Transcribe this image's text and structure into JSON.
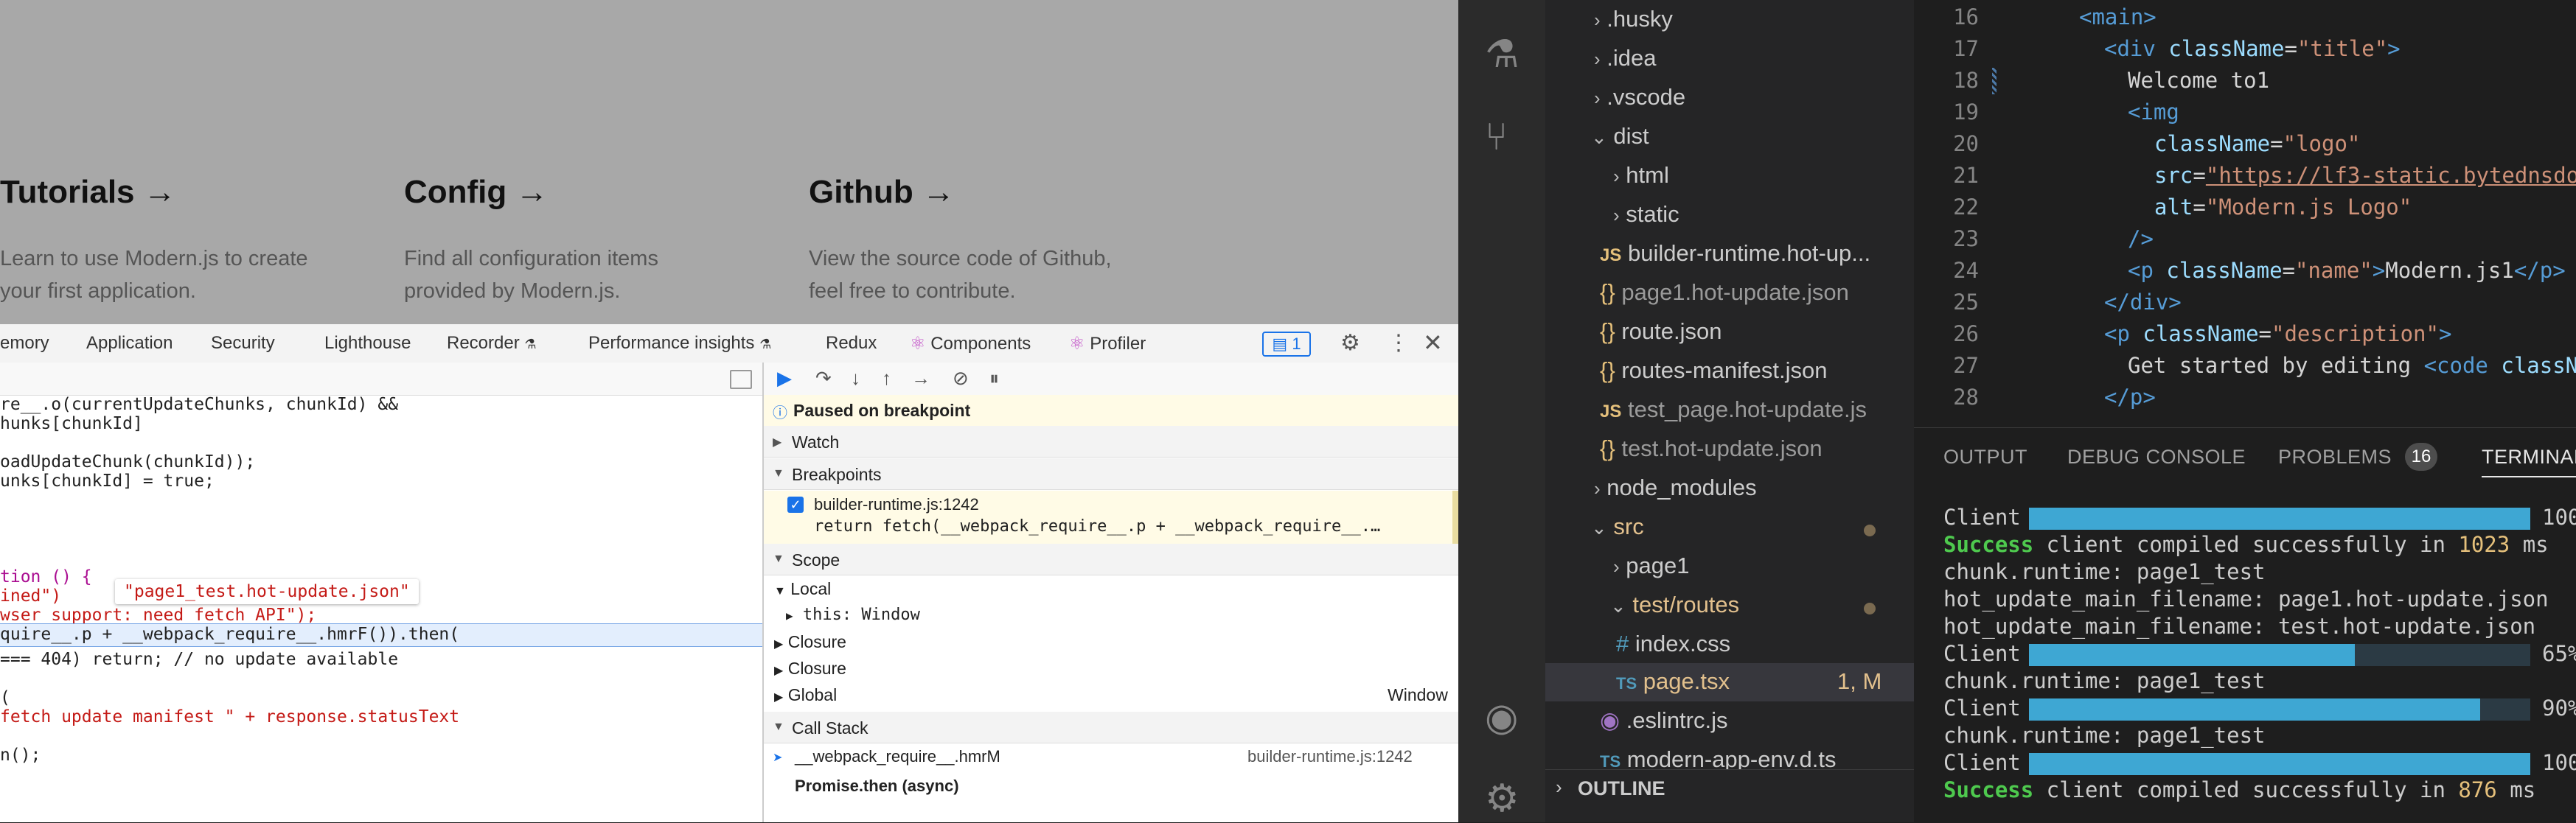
{
  "browser": {
    "cards": [
      {
        "title": "Tutorials →",
        "desc1": "Learn to use Modern.js to create",
        "desc2": "your first application."
      },
      {
        "title": "Config →",
        "desc1": "Find all configuration items",
        "desc2": "provided by Modern.js."
      },
      {
        "title": "Github →",
        "desc1": "View the source code of Github,",
        "desc2": "feel free to contribute."
      }
    ]
  },
  "devtools": {
    "tabs": [
      "emory",
      "Application",
      "Security",
      "Lighthouse",
      "Recorder",
      "Performance insights",
      "Redux",
      "Components",
      "Profiler"
    ],
    "issue_count": "1",
    "code_lines": [
      "re__.o(currentUpdateChunks, chunkId) &&",
      "hunks[chunkId]",
      "",
      "oadUpdateChunk(chunkId));",
      "unks[chunkId] = true;",
      "",
      "",
      "",
      "tion () {",
      "ined\")",
      "wser support: need fetch API\");",
      "quire__.p + __webpack_require__.hmrF()).then(",
      "=== 404) return; // no update available",
      "",
      "(",
      "fetch update manifest \" + response.statusText",
      "",
      "n();"
    ],
    "tooltip": "\"page1_test.hot-update.json\"",
    "paused_text": "Paused on breakpoint",
    "sections": {
      "watch": "Watch",
      "breakpoints": "Breakpoints",
      "scope": "Scope",
      "call_stack": "Call Stack"
    },
    "breakpoint_file": "builder-runtime.js:1242",
    "breakpoint_code": "return fetch(__webpack_require__.p + __webpack_require__.…",
    "scope": {
      "local": "Local",
      "this_label": "this: Window",
      "closure1": "Closure",
      "closure2": "Closure",
      "global": "Global",
      "global_value": "Window"
    },
    "call_stack": {
      "frame1": "__webpack_require__.hmrM",
      "frame1_loc": "builder-runtime.js:1242",
      "frame2": "Promise.then (async)"
    }
  },
  "vscode": {
    "explorer_items": [
      {
        "label": ".husky",
        "kind": "folder-closed"
      },
      {
        "label": ".idea",
        "kind": "folder-closed"
      },
      {
        "label": ".vscode",
        "kind": "folder-closed"
      },
      {
        "label": "dist",
        "kind": "folder-open"
      },
      {
        "label": "html",
        "kind": "folder-closed"
      },
      {
        "label": "static",
        "kind": "folder-closed"
      },
      {
        "label": "builder-runtime.hot-up...",
        "kind": "js"
      },
      {
        "label": "page1.hot-update.json",
        "kind": "json"
      },
      {
        "label": "route.json",
        "kind": "json"
      },
      {
        "label": "routes-manifest.json",
        "kind": "json"
      },
      {
        "label": "test_page.hot-update.js",
        "kind": "js"
      },
      {
        "label": "test.hot-update.json",
        "kind": "json"
      },
      {
        "label": "node_modules",
        "kind": "folder-closed"
      },
      {
        "label": "src",
        "kind": "folder-open"
      },
      {
        "label": "page1",
        "kind": "folder-closed"
      },
      {
        "label": "test/routes",
        "kind": "folder-open"
      },
      {
        "label": "index.css",
        "kind": "css"
      },
      {
        "label": "page.tsx",
        "kind": "ts"
      },
      {
        "label": ".eslintrc.js",
        "kind": "eslint"
      },
      {
        "label": "modern-app-env.d.ts",
        "kind": "ts"
      }
    ],
    "page_tsx_badge": "1, M",
    "outline_label": "OUTLINE",
    "line_numbers": [
      "16",
      "17",
      "18",
      "19",
      "20",
      "21",
      "22",
      "23",
      "24",
      "25",
      "26",
      "27",
      "28"
    ],
    "panel_tabs": [
      "OUTPUT",
      "DEBUG CONSOLE",
      "PROBLEMS",
      "TERMINAL"
    ],
    "problems_count": "16",
    "terminal": [
      {
        "prefix": "Client",
        "progress": 1.0,
        "pct": "100"
      },
      {
        "text_success": "Success",
        "text": " client compiled successfully in ",
        "num": "1023",
        "suffix": " ms"
      },
      {
        "text": "chunk.runtime: page1_test"
      },
      {
        "text": "hot_update_main_filename: page1.hot-update.json"
      },
      {
        "text": "hot_update_main_filename: test.hot-update.json"
      },
      {
        "prefix": "Client",
        "progress": 0.65,
        "pct": "65%"
      },
      {
        "text": "chunk.runtime: page1_test"
      },
      {
        "prefix": "Client",
        "progress": 0.9,
        "pct": "90%"
      },
      {
        "text": "chunk.runtime: page1_test"
      },
      {
        "prefix": "Client",
        "progress": 1.0,
        "pct": "100"
      },
      {
        "text_success": "Success",
        "text": " client compiled successfully in ",
        "num": "876",
        "suffix": " ms"
      }
    ],
    "code": {
      "l16": "<main>",
      "l17_tag": "div",
      "l17_attr": "className",
      "l17_val": "\"title\"",
      "l18": "Welcome to1",
      "l19": "<img",
      "l20_attr": "className",
      "l20_val": "\"logo\"",
      "l21_attr": "src",
      "l21_val": "\"https://lf3-static.bytednsdo",
      "l22_attr": "alt",
      "l22_val": "\"Modern.js Logo\"",
      "l23": "/>",
      "l24_attr": "className",
      "l24_val": "\"name\"",
      "l24_text": "Modern.js1",
      "l25": "</div>",
      "l26_attr": "className",
      "l26_val": "\"description\"",
      "l27_text": "Get started by editing ",
      "l27_attr": "classN",
      "l28": "</p>"
    }
  },
  "colors": {
    "progress": "#3ea7d3",
    "success": "#4ec94e",
    "breakpoint_bg": "#fffbe6"
  }
}
